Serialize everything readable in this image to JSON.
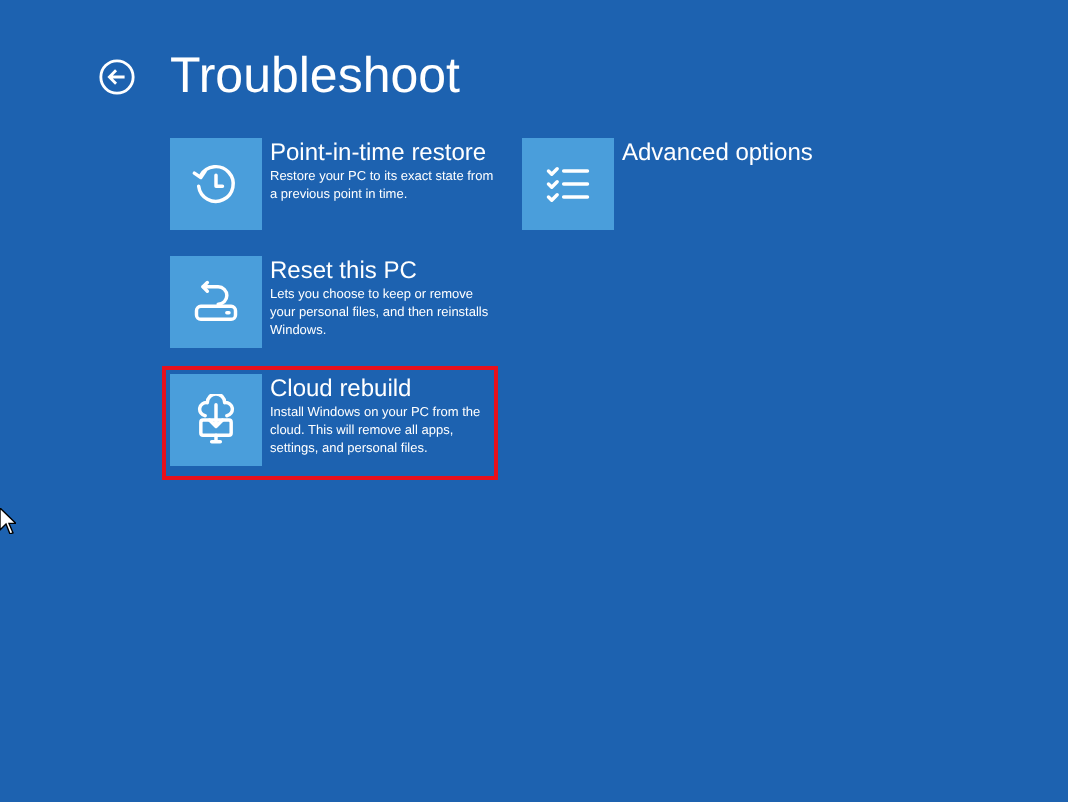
{
  "title": "Troubleshoot",
  "columns": [
    [
      {
        "kind": "restore",
        "title": "Point-in-time restore",
        "description": "Restore your PC to its exact state from a previous point in time.",
        "highlighted": false
      },
      {
        "kind": "reset",
        "title": "Reset this PC",
        "description": "Lets you choose to keep or remove your personal files, and then reinstalls Windows.",
        "highlighted": false
      },
      {
        "kind": "cloud",
        "title": "Cloud rebuild",
        "description": "Install Windows on your PC from the cloud. This will remove all apps, settings, and personal files.",
        "highlighted": true
      }
    ],
    [
      {
        "kind": "advanced",
        "title": "Advanced options",
        "highlighted": false
      }
    ]
  ]
}
